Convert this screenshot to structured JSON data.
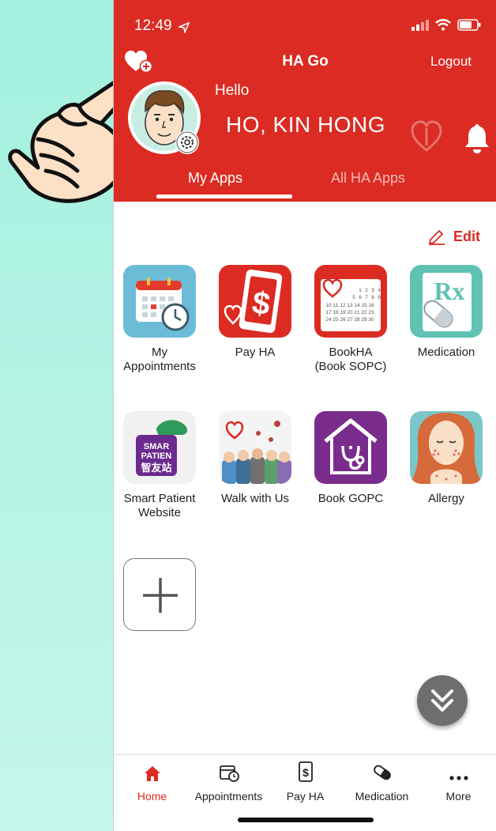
{
  "status_bar": {
    "time": "12:49"
  },
  "header": {
    "title": "HA Go",
    "logout_label": "Logout",
    "greeting": "Hello",
    "user_name": "HO, KIN HONG",
    "tabs": [
      {
        "label": "My Apps",
        "active": true
      },
      {
        "label": "All HA Apps",
        "active": false
      }
    ]
  },
  "edit_label": "Edit",
  "apps": [
    {
      "label": "My\nAppointments",
      "icon": "calendar-clock-icon"
    },
    {
      "label": "Pay HA",
      "icon": "pay-ha-icon"
    },
    {
      "label": "BookHA\n(Book SOPC)",
      "icon": "bookha-calendar-icon"
    },
    {
      "label": "Medication",
      "icon": "rx-medication-icon"
    },
    {
      "label": "Smart Patient\nWebsite",
      "icon": "smart-patient-icon"
    },
    {
      "label": "Walk with Us",
      "icon": "walk-with-us-icon"
    },
    {
      "label": "Book GOPC",
      "icon": "book-gopc-icon"
    },
    {
      "label": "Allergy",
      "icon": "allergy-icon"
    }
  ],
  "smart_patient_logo": {
    "line1": "SMAR",
    "line2": "PATIEN",
    "line3": "智友站"
  },
  "bottom_nav": [
    {
      "label": "Home",
      "icon": "home-icon",
      "active": true
    },
    {
      "label": "Appointments",
      "icon": "appointments-icon",
      "active": false
    },
    {
      "label": "Pay HA",
      "icon": "pay-ha-icon",
      "active": false
    },
    {
      "label": "Medication",
      "icon": "pill-icon",
      "active": false
    },
    {
      "label": "More",
      "icon": "more-icon",
      "active": false
    }
  ],
  "colors": {
    "brand_red": "#db2b22",
    "background_mint": "#a3f0df"
  }
}
